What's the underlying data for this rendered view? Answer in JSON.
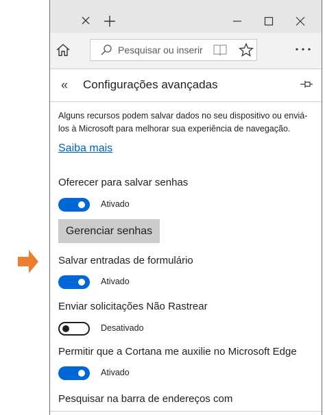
{
  "colors": {
    "accent": "#0067d6",
    "link": "#0063b1",
    "arrow": "#ed7d31",
    "titlebar": "#e6e6e6",
    "button_bg": "#cccccc"
  },
  "browser": {
    "address_placeholder": "Pesquisar ou inserir",
    "icons": [
      "close-icon",
      "plus-icon",
      "minimize-icon",
      "maximize-icon",
      "close-window-icon",
      "home-icon",
      "search-icon",
      "reading-view-icon",
      "star-icon",
      "more-icon"
    ]
  },
  "panel": {
    "back_glyph": "«",
    "title": "Configurações avançadas",
    "description": "Alguns recursos podem salvar dados no seu dispositivo ou enviá-los à Microsoft para melhorar sua experiência de navegação.",
    "learn_more": "Saiba mais",
    "settings": [
      {
        "label": "Oferecer para salvar senhas",
        "state": "Ativado",
        "on": true
      },
      {
        "label": "Salvar entradas de formulário",
        "state": "Ativado",
        "on": true
      },
      {
        "label": "Enviar solicitações Não Rastrear",
        "state": "Desativado",
        "on": false
      },
      {
        "label": "Permitir que a Cortana me auxilie no Microsoft Edge",
        "state": "Ativado",
        "on": true
      }
    ],
    "manage_passwords": "Gerenciar senhas",
    "next_section": "Pesquisar na barra de endereços com"
  }
}
